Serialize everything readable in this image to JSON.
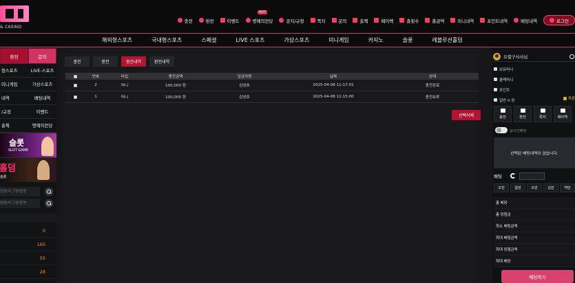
{
  "header": {
    "logo_text": "& CASINO",
    "top_links": [
      {
        "label": "충전",
        "icon": "plus-icon"
      },
      {
        "label": "환전",
        "icon": "minus-icon"
      },
      {
        "label": "이벤트",
        "icon": "gift-icon"
      },
      {
        "label": "명예의전당",
        "icon": "crown-icon",
        "badge": "HOT"
      },
      {
        "label": "공지/규정",
        "icon": "info-icon"
      },
      {
        "label": "쪽지",
        "icon": "message-icon"
      },
      {
        "label": "문의",
        "icon": "question-icon"
      },
      {
        "label": "출첵",
        "icon": "calendar-icon"
      },
      {
        "label": "페이백",
        "icon": "payback-icon"
      },
      {
        "label": "총횟수",
        "icon": "hand-icon"
      },
      {
        "label": "총금액",
        "icon": "money-icon"
      },
      {
        "label": "미니내역",
        "icon": "list-icon"
      },
      {
        "label": "포인트내역",
        "icon": "point-icon"
      },
      {
        "label": "배팅내역",
        "icon": "check-icon"
      }
    ],
    "login_label": "로그인"
  },
  "main_nav": [
    "해외형스포츠",
    "국내형스포츠",
    "스페셜",
    "LIVE 스포츠",
    "가상스포츠",
    "미니게임",
    "카지노",
    "슬롯",
    "레볼루션홀덤"
  ],
  "sidebar": {
    "tabs": [
      "환전",
      "문의"
    ],
    "links": [
      [
        "형스포츠",
        "LIVE-스포츠"
      ],
      [
        "미니게임",
        "가상스포츠"
      ],
      [
        "내역",
        "배팅내역"
      ],
      [
        "/규정",
        "이벤트"
      ],
      [
        "출첵",
        "명예의전당"
      ]
    ],
    "banner1_title": "슬롯",
    "banner1_subtitle": "SLOT GAME",
    "banner2_title": "홀덤",
    "banner2_subtitle": "슬롯",
    "search_placeholders": [
      "팀명/리그명/팀명",
      "팀명/리그명/팀명"
    ],
    "counts": [
      "0",
      "165",
      "55",
      "28"
    ]
  },
  "main": {
    "tabs": [
      "충전",
      "환전",
      "충전내역",
      "환전내역"
    ],
    "active_tab": "충전내역",
    "columns": [
      "번호",
      "타입",
      "충전금액",
      "입금자명",
      "날짜",
      "상태"
    ],
    "rows": [
      [
        "2",
        "머니",
        "100,000 원",
        "김성호",
        "2025-04-08 11:17:01",
        "충전완료"
      ],
      [
        "1",
        "머니",
        "100,000 원",
        "김성호",
        "2025-04-08 11:15:00",
        "충전보류"
      ]
    ],
    "delete_label": "선택삭제"
  },
  "right_panel": {
    "username": "오렬구사사님",
    "rows": [
      "보유머니",
      "콜렉머니",
      "포인트",
      "일반 0 장"
    ],
    "coupon": "쿠폰",
    "quick_buttons": [
      "충전",
      "환전",
      "쪽지",
      "페이백"
    ],
    "toggle_label": "실시간배당",
    "slip_message": "선택된 배팅내역이 없습니다.",
    "bet_label": "배팅",
    "amount_buttons": [
      "오천",
      "일만",
      "오만",
      "십만",
      "백만"
    ],
    "bet_rows": [
      "총 배당",
      "총 당첨금",
      "최소 배팅금액",
      "최대 배팅금액",
      "최대 당첨금액",
      "최대 배당"
    ],
    "bet_button": "배팅하기"
  }
}
